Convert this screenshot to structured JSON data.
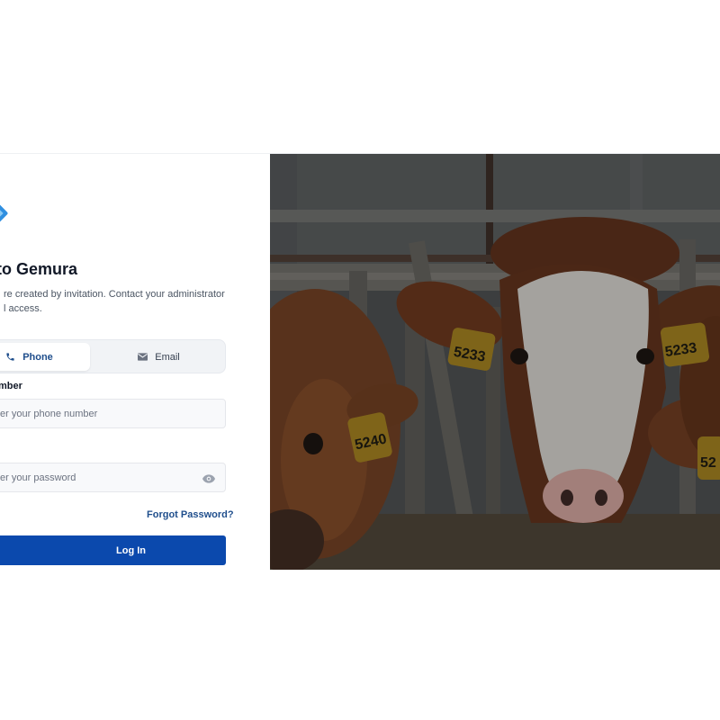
{
  "login": {
    "title": "n to Gemura",
    "subtitle_line1": "re created by invitation. Contact your administrator",
    "subtitle_line2": "l access.",
    "tabs": {
      "phone_label": "Phone",
      "email_label": "Email",
      "active": "phone"
    },
    "phone_field": {
      "label": "mber",
      "placeholder": "ter your phone number"
    },
    "password_field": {
      "placeholder": "ter your password"
    },
    "forgot_label": "Forgot Password?",
    "login_label": "Log In"
  },
  "hero": {
    "ear_tags": [
      "5233",
      "5240",
      "5233",
      "52"
    ]
  },
  "colors": {
    "primary": "#0b49ad",
    "link": "#1f4e8c",
    "logo": "#2f8fe0"
  }
}
